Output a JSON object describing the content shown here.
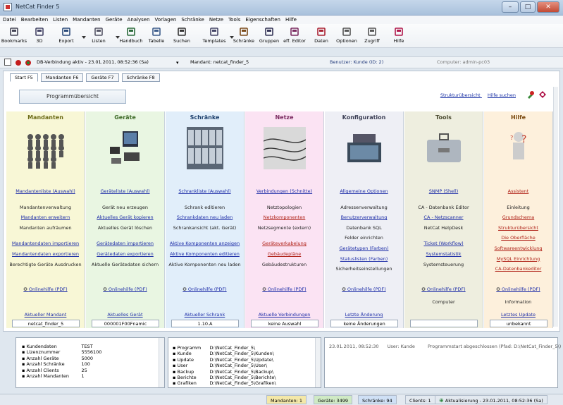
{
  "window": {
    "title": "NetCat Finder 5"
  },
  "menu": [
    "Datei",
    "Bearbeiten",
    "Listen",
    "Mandanten",
    "Geräte",
    "Analysen",
    "Vorlagen",
    "Schränke",
    "Netze",
    "Tools",
    "Eigenschaften",
    "Hilfe"
  ],
  "toolbar": [
    {
      "label": "Bookmarks"
    },
    {
      "label": "3D"
    },
    {
      "label": "Export"
    },
    {
      "label": "Listen"
    },
    {
      "label": "Handbuch"
    },
    {
      "label": "Tabelle"
    },
    {
      "label": "Suchen"
    },
    {
      "label": "Templates"
    },
    {
      "label": "Schränke"
    },
    {
      "label": "Gruppen"
    },
    {
      "label": "eff. Editor"
    },
    {
      "label": "Daten"
    },
    {
      "label": "Optionen"
    },
    {
      "label": "Zugriff"
    },
    {
      "label": "Hilfe"
    }
  ],
  "info": {
    "db_status": "DB-Verbindung aktiv - 23.01.2011, 08:52:36 (Sa)",
    "mandant": "Mandant: netcat_finder_5",
    "benutzer": "Benutzer: Kunde (ID: 2)",
    "computer": "Computer: admin-pc03"
  },
  "tabs": [
    "Start F5",
    "Mandanten F6",
    "Geräte F7",
    "Schränke F8"
  ],
  "overview_label": "Programmübersicht",
  "toplinks": [
    "Strukturübersicht",
    "Hilfe suchen"
  ],
  "columns": [
    {
      "title": "Mandanten",
      "color": "#f8f7d6",
      "title_color": "#6c6b17",
      "items": [
        {
          "t": "Mandantenliste (Auswahl)",
          "k": "lk"
        },
        {
          "t": "",
          "k": "sp"
        },
        {
          "t": "Mandantenverwaltung",
          "k": "txt"
        },
        {
          "t": "Mandanten erweitern",
          "k": "lk"
        },
        {
          "t": "Mandanten aufräumen",
          "k": "txt"
        },
        {
          "t": "",
          "k": "sp"
        },
        {
          "t": "Mandantendaten importieren",
          "k": "lk"
        },
        {
          "t": "Mandantendaten exportieren",
          "k": "lk"
        },
        {
          "t": "Berechtigte Geräte Ausdrucken",
          "k": "txt"
        }
      ],
      "help": "Onlinehilfe (PDF)",
      "aktuell": "Aktueller Mandant",
      "foot": "netcat_finder_5"
    },
    {
      "title": "Geräte",
      "color": "#e9f6e2",
      "title_color": "#3d6a27",
      "items": [
        {
          "t": "Geräteliste (Auswahl)",
          "k": "lk"
        },
        {
          "t": "",
          "k": "sp"
        },
        {
          "t": "Gerät neu erzeugen",
          "k": "txt"
        },
        {
          "t": "Aktuelles Gerät kopieren",
          "k": "lk"
        },
        {
          "t": "Aktuelles Gerät löschen",
          "k": "txt"
        },
        {
          "t": "",
          "k": "sp"
        },
        {
          "t": "Gerätedaten importieren",
          "k": "lk"
        },
        {
          "t": "Gerätedaten exportieren",
          "k": "lk"
        },
        {
          "t": "Aktuelle Gerätedaten sichern",
          "k": "txt"
        }
      ],
      "help": "Onlinehilfe (PDF)",
      "aktuell": "Aktuelles Gerät",
      "foot": "000001F00Fnamic"
    },
    {
      "title": "Schränke",
      "color": "#e1eefa",
      "title_color": "#1c3f6c",
      "items": [
        {
          "t": "Schrankliste (Auswahl)",
          "k": "lk"
        },
        {
          "t": "",
          "k": "sp"
        },
        {
          "t": "Schrank editieren",
          "k": "txt"
        },
        {
          "t": "Schrankdaten neu laden",
          "k": "lk"
        },
        {
          "t": "Schrankansicht (akt. Gerät)",
          "k": "txt"
        },
        {
          "t": "",
          "k": "sp"
        },
        {
          "t": "Aktive Komponenten anzeigen",
          "k": "lk"
        },
        {
          "t": "Aktive Komponenten editieren",
          "k": "lk"
        },
        {
          "t": "Aktive Komponenten neu laden",
          "k": "txt"
        }
      ],
      "help": "Onlinehilfe (PDF)",
      "aktuell": "Aktueller Schrank",
      "foot": "1.10.A"
    },
    {
      "title": "Netze",
      "color": "#fbe3f3",
      "title_color": "#7a2a60",
      "items": [
        {
          "t": "Verbindungen (Schnitte)",
          "k": "lk"
        },
        {
          "t": "",
          "k": "sp"
        },
        {
          "t": "Netztopologien",
          "k": "txt"
        },
        {
          "t": "Netzkomponenten",
          "k": "act"
        },
        {
          "t": "Netzsegmente (extern)",
          "k": "txt"
        },
        {
          "t": "",
          "k": "sp"
        },
        {
          "t": "Geräteverkabelung",
          "k": "act"
        },
        {
          "t": "Gebäudepläne",
          "k": "act"
        },
        {
          "t": "Gebäudestrukturen",
          "k": "txt"
        }
      ],
      "help": "Onlinehilfe (PDF)",
      "aktuell": "Aktuelle Verbindungen",
      "foot": "keine Auswahl"
    },
    {
      "title": "Konfiguration",
      "color": "#eeeff5",
      "title_color": "#3c3f55",
      "items": [
        {
          "t": "Allgemeine Optionen",
          "k": "lk"
        },
        {
          "t": "",
          "k": "sp"
        },
        {
          "t": "Adressenverwaltung",
          "k": "txt"
        },
        {
          "t": "Benutzerverwaltung",
          "k": "lk"
        },
        {
          "t": "Datenbank SQL",
          "k": "txt"
        },
        {
          "t": "Felder einrichten",
          "k": "txt"
        },
        {
          "t": "Gerätetypen (Farben)",
          "k": "lk"
        },
        {
          "t": "Statuslisten (Farben)",
          "k": "lk"
        },
        {
          "t": "Sicherheitseinstellungen",
          "k": "txt"
        }
      ],
      "help": "Onlinehilfe (PDF)",
      "aktuell": "Letzte Änderung",
      "foot": "keine Änderungen"
    },
    {
      "title": "Tools",
      "color": "#eeeedf",
      "title_color": "#4a4a30",
      "items": [
        {
          "t": "SNMP (Shell)",
          "k": "lk"
        },
        {
          "t": "",
          "k": "sp"
        },
        {
          "t": "CA - Datenbank Editor",
          "k": "txt"
        },
        {
          "t": "CA - Netzscanner",
          "k": "lk"
        },
        {
          "t": "NetCat HelpDesk",
          "k": "txt"
        },
        {
          "t": "",
          "k": "sp"
        },
        {
          "t": "Ticket (Workflow)",
          "k": "lk"
        },
        {
          "t": "Systemstatistik",
          "k": "lk"
        },
        {
          "t": "Systemsteuerung",
          "k": "txt"
        }
      ],
      "help": "Onlinehilfe (PDF)",
      "aktuell": "Computer",
      "foot": ""
    },
    {
      "title": "Hilfe",
      "color": "#fdf0dc",
      "title_color": "#7a4a10",
      "items": [
        {
          "t": "Assistent",
          "k": "act"
        },
        {
          "t": "",
          "k": "sp"
        },
        {
          "t": "Einleitung",
          "k": "txt"
        },
        {
          "t": "Grundschema",
          "k": "act"
        },
        {
          "t": "Strukturübersicht",
          "k": "act"
        },
        {
          "t": "Die Oberfläche",
          "k": "act"
        },
        {
          "t": "Softwareentwicklung",
          "k": "act"
        },
        {
          "t": "MySQL Einrichtung",
          "k": "act"
        },
        {
          "t": "CA-Datenbankeditor",
          "k": "act"
        }
      ],
      "help": "Onlinehilfe (PDF)",
      "aktuell": "Information",
      "aktuell2": "Letztes Update",
      "foot": "unbekannt"
    }
  ],
  "stats": [
    {
      "label": "Kundendaten",
      "value": "TEST"
    },
    {
      "label": "Lizenznummer",
      "value": "5556100"
    },
    {
      "label": "Anzahl Geräte",
      "value": "5000"
    },
    {
      "label": "Anzahl Schränke",
      "value": "100"
    },
    {
      "label": "Anzahl Clients",
      "value": "25"
    },
    {
      "label": "Anzahl Mandanten",
      "value": "1"
    }
  ],
  "paths": [
    {
      "label": "Programm",
      "value": "D:\\NetCat_Finder_5\\"
    },
    {
      "label": "Kunde",
      "value": "D:\\NetCat_Finder_5\\Kunden\\"
    },
    {
      "label": "Update",
      "value": "D:\\NetCat_Finder_5\\Update\\"
    },
    {
      "label": "User",
      "value": "D:\\NetCat_Finder_5\\User\\"
    },
    {
      "label": "Backup",
      "value": "D:\\NetCat_Finder_5\\Backup\\"
    },
    {
      "label": "Berichte",
      "value": "D:\\NetCat_Finder_5\\Berichte\\"
    },
    {
      "label": "Grafiken",
      "value": "D:\\NetCat_Finder_5\\Grafiken\\"
    }
  ],
  "log": {
    "time": "23.01.2011, 08:52:30",
    "user": "User: Kunde",
    "message": "Programmstart abgeschlossen (Pfad: D:\\NetCat_Finder_5\\)"
  },
  "status": {
    "mandanten": "Mandanten: 1",
    "geraete": "Geräte: 3499",
    "schraenke": "Schränke: 94",
    "clients": "Clients: 1",
    "aktualisierung": "Aktualisierung - 23.01.2011, 08:52:36 (Sa)"
  }
}
